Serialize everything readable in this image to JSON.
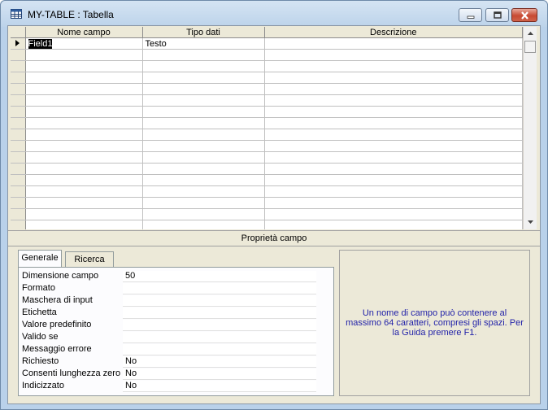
{
  "window": {
    "title": "MY-TABLE : Tabella",
    "icon": "table-icon",
    "controls": [
      "minimize-icon",
      "maximize-icon",
      "close-icon"
    ]
  },
  "grid": {
    "columns": [
      "Nome campo",
      "Tipo dati",
      "Descrizione"
    ],
    "rows": [
      {
        "field_name": "Field1",
        "data_type": "Testo",
        "description": ""
      },
      {
        "field_name": "",
        "data_type": "",
        "description": ""
      },
      {
        "field_name": "",
        "data_type": "",
        "description": ""
      },
      {
        "field_name": "",
        "data_type": "",
        "description": ""
      },
      {
        "field_name": "",
        "data_type": "",
        "description": ""
      },
      {
        "field_name": "",
        "data_type": "",
        "description": ""
      },
      {
        "field_name": "",
        "data_type": "",
        "description": ""
      },
      {
        "field_name": "",
        "data_type": "",
        "description": ""
      },
      {
        "field_name": "",
        "data_type": "",
        "description": ""
      },
      {
        "field_name": "",
        "data_type": "",
        "description": ""
      },
      {
        "field_name": "",
        "data_type": "",
        "description": ""
      },
      {
        "field_name": "",
        "data_type": "",
        "description": ""
      },
      {
        "field_name": "",
        "data_type": "",
        "description": ""
      },
      {
        "field_name": "",
        "data_type": "",
        "description": ""
      },
      {
        "field_name": "",
        "data_type": "",
        "description": ""
      },
      {
        "field_name": "",
        "data_type": "",
        "description": ""
      },
      {
        "field_name": "",
        "data_type": "",
        "description": ""
      }
    ]
  },
  "properties": {
    "header": "Proprietà campo",
    "tabs": [
      "Generale",
      "Ricerca"
    ],
    "rows": [
      {
        "label": "Dimensione campo",
        "value": "50"
      },
      {
        "label": "Formato",
        "value": ""
      },
      {
        "label": "Maschera di input",
        "value": ""
      },
      {
        "label": "Etichetta",
        "value": ""
      },
      {
        "label": "Valore predefinito",
        "value": ""
      },
      {
        "label": "Valido se",
        "value": ""
      },
      {
        "label": "Messaggio errore",
        "value": ""
      },
      {
        "label": "Richiesto",
        "value": "No"
      },
      {
        "label": "Consenti lunghezza zero",
        "value": "No"
      },
      {
        "label": "Indicizzato",
        "value": "No"
      }
    ],
    "help_text": "Un nome di campo può contenere al massimo 64 caratteri, compresi gli spazi. Per la Guida premere F1."
  }
}
